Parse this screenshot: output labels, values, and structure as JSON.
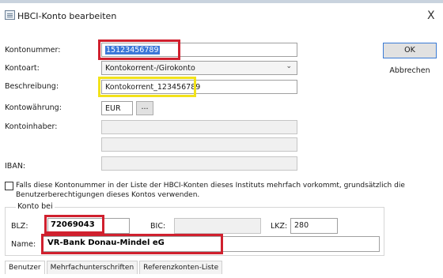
{
  "window": {
    "title": "HBCI-Konto bearbeiten",
    "close_glyph": "X"
  },
  "buttons": {
    "ok": "OK",
    "cancel": "Abbrechen",
    "browse": "..."
  },
  "form": {
    "kontonummer_label": "Kontonummer:",
    "kontonummer_value": "15123456789",
    "kontoart_label": "Kontoart:",
    "kontoart_value": "Kontokorrent-/Girokonto",
    "beschreibung_label": "Beschreibung:",
    "beschreibung_value": "Kontokorrent_123456789",
    "waehrung_label": "Kontowährung:",
    "waehrung_value": "EUR",
    "inhaber_label": "Kontoinhaber:",
    "iban_label": "IBAN:",
    "checkbox_text_line1": "Falls diese Kontonummer in der Liste der HBCI-Konten dieses Instituts mehrfach vorkommt, grundsätzlich die",
    "checkbox_text_line2": "Benutzerberechtigungen dieses Kontos verwenden."
  },
  "konto_bei": {
    "legend": "Konto bei",
    "blz_label": "BLZ:",
    "blz_value": "72069043",
    "bic_label": "BIC:",
    "lkz_label": "LKZ:",
    "lkz_value": "280",
    "name_label": "Name:",
    "name_value": "VR-Bank Donau-Mindel eG"
  },
  "tabs": [
    "Benutzer",
    "Mehrfachunterschriften",
    "Referenzkonten-Liste"
  ],
  "colors": {
    "highlight_red": "#d0202e",
    "highlight_yellow": "#f2e21a",
    "selection_blue": "#3b78d8"
  }
}
